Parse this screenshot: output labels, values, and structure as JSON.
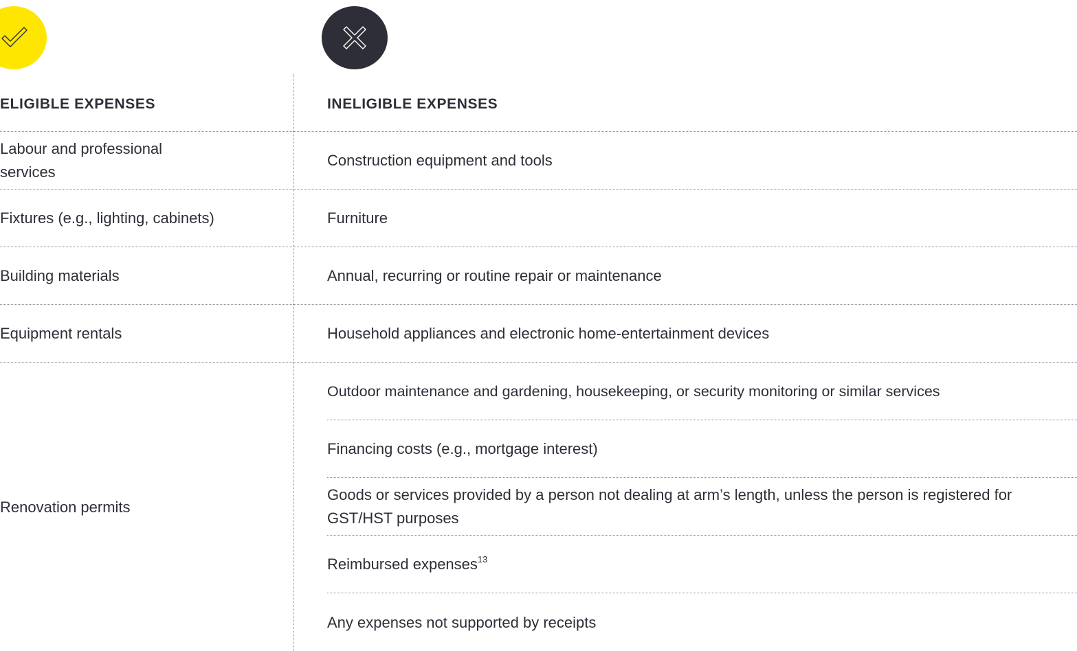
{
  "eligible": {
    "heading": "ELIGIBLE EXPENSES",
    "icon": "check-icon",
    "icon_color": "#ffe600",
    "items": [
      "Labour and professional services",
      "Fixtures (e.g., lighting, cabinets)",
      "Building materials",
      "Equipment rentals",
      "Renovation permits"
    ]
  },
  "ineligible": {
    "heading": "INELIGIBLE EXPENSES",
    "icon": "cross-icon",
    "icon_color": "#2e2e38",
    "items": [
      "Construction equipment and tools",
      "Furniture",
      "Annual, recurring or routine repair or maintenance",
      "Household appliances and electronic home-entertainment devices",
      "Outdoor maintenance and gardening, housekeeping, or security monitoring or similar services",
      "Financing costs (e.g., mortgage interest)",
      "Goods or services provided by a person not dealing at arm’s length, unless the person is registered for GST/HST purposes",
      "Reimbursed expenses",
      "Any expenses not supported by receipts"
    ],
    "footnote_ref": "13"
  }
}
